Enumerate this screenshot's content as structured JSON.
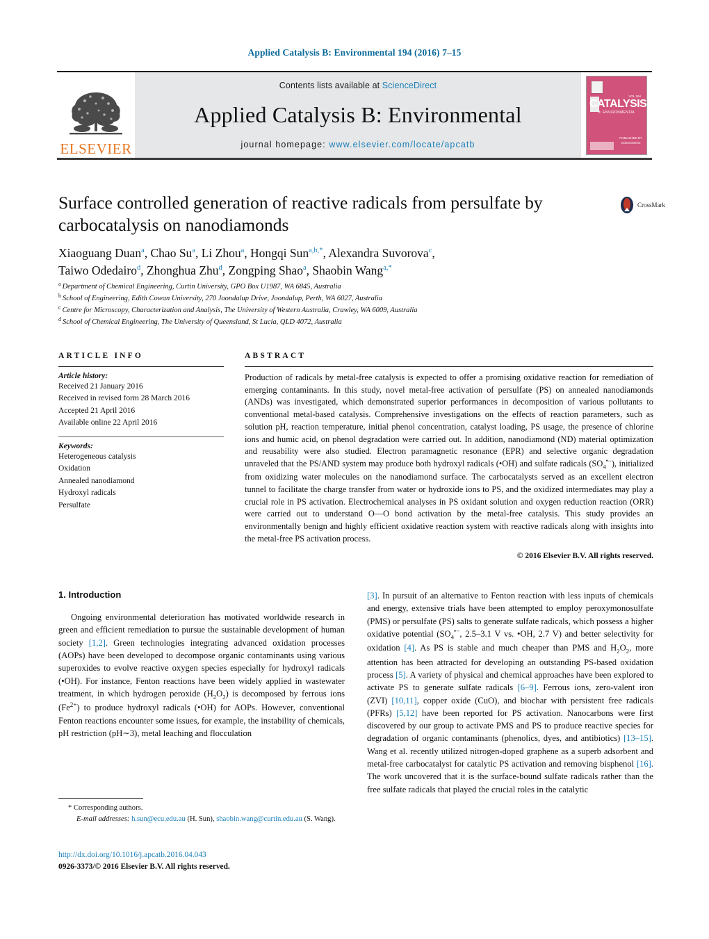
{
  "running_head": "Applied Catalysis B: Environmental 194 (2016) 7–15",
  "masthead": {
    "contents_prefix": "Contents lists available at ",
    "contents_link": "ScienceDirect",
    "journal_title": "Applied Catalysis B: Environmental",
    "homepage_prefix": "journal homepage: ",
    "homepage_url": "www.elsevier.com/locate/apcatb",
    "publisher": "ELSEVIER",
    "cover": {
      "title": "CATALYSIS",
      "subtitle": "B: ENVIRONMENTAL",
      "corner_label": "VOL 194",
      "footer_label": "PUBLISHED BY",
      "footer_brand": "ScienceDirect"
    }
  },
  "title": "Surface controlled generation of reactive radicals from persulfate by carbocatalysis on nanodiamonds",
  "crossmark": {
    "label": "CrossMark"
  },
  "authors_line_1": "Xiaoguang Duan<sup>a</sup>, Chao Su<sup>a</sup>, Li Zhou<sup>a</sup>, Hongqi Sun<sup>a,b,*</sup>, Alexandra Suvorova<sup>c</sup>,",
  "authors_line_2": "Taiwo Odedairo<sup>d</sup>, Zhonghua Zhu<sup>d</sup>, Zongping Shao<sup>a</sup>, Shaobin Wang<sup>a,*</sup>",
  "affiliations": [
    {
      "marker": "a",
      "text": "Department of Chemical Engineering, Curtin University, GPO Box U1987, WA 6845, Australia"
    },
    {
      "marker": "b",
      "text": "School of Engineering, Edith Cowan University, 270 Joondalup Drive, Joondalup, Perth, WA 6027, Australia"
    },
    {
      "marker": "c",
      "text": "Centre for Microscopy, Characterization and Analysis, The University of Western Australia, Crawley, WA 6009, Australia"
    },
    {
      "marker": "d",
      "text": "School of Chemical Engineering, The University of Queensland, St Lucia, QLD 4072, Australia"
    }
  ],
  "article_info": {
    "heading": "ARTICLE INFO",
    "history_label": "Article history:",
    "history": [
      "Received 21 January 2016",
      "Received in revised form 28 March 2016",
      "Accepted 21 April 2016",
      "Available online 22 April 2016"
    ],
    "keywords_label": "Keywords:",
    "keywords": [
      "Heterogeneous catalysis",
      "Oxidation",
      "Annealed nanodiamond",
      "Hydroxyl radicals",
      "Persulfate"
    ]
  },
  "abstract": {
    "heading": "ABSTRACT",
    "text": "Production of radicals by metal-free catalysis is expected to offer a promising oxidative reaction for remediation of emerging contaminants. In this study, novel metal-free activation of persulfate (PS) on annealed nanodiamonds (ANDs) was investigated, which demonstrated superior performances in decomposition of various pollutants to conventional metal-based catalysis. Comprehensive investigations on the effects of reaction parameters, such as solution pH, reaction temperature, initial phenol concentration, catalyst loading, PS usage, the presence of chlorine ions and humic acid, on phenol degradation were carried out. In addition, nanodiamond (ND) material optimization and reusability were also studied. Electron paramagnetic resonance (EPR) and selective organic degradation unraveled that the PS/AND system may produce both hydroxyl radicals (•OH) and sulfate radicals (SO4•−), initialized from oxidizing water molecules on the nanodiamond surface. The carbocatalysts served as an excellent electron tunnel to facilitate the charge transfer from water or hydroxide ions to PS, and the oxidized intermediates may play a crucial role in PS activation. Electrochemical analyses in PS oxidant solution and oxygen reduction reaction (ORR) were carried out to understand O—O bond activation by the metal-free catalysis. This study provides an environmentally benign and highly efficient oxidative reaction system with reactive radicals along with insights into the metal-free PS activation process.",
    "copyright": "© 2016 Elsevier B.V. All rights reserved."
  },
  "body": {
    "section_heading": "1. Introduction",
    "left_paragraph": "Ongoing environmental deterioration has motivated worldwide research in green and efficient remediation to pursue the sustainable development of human society [1,2]. Green technologies integrating advanced oxidation processes (AOPs) have been developed to decompose organic contaminants using various superoxides to evolve reactive oxygen species especially for hydroxyl radicals (•OH). For instance, Fenton reactions have been widely applied in wastewater treatment, in which hydrogen peroxide (H2O2) is decomposed by ferrous ions (Fe2+) to produce hydroxyl radicals (•OH) for AOPs. However, conventional Fenton reactions encounter some issues, for example, the instability of chemicals, pH restriction (pH∼3), metal leaching and flocculation",
    "right_paragraph": "[3]. In pursuit of an alternative to Fenton reaction with less inputs of chemicals and energy, extensive trials have been attempted to employ peroxymonosulfate (PMS) or persulfate (PS) salts to generate sulfate radicals, which possess a higher oxidative potential (SO4•−, 2.5–3.1 V vs. •OH, 2.7 V) and better selectivity for oxidation [4]. As PS is stable and much cheaper than PMS and H2O2, more attention has been attracted for developing an outstanding PS-based oxidation process [5]. A variety of physical and chemical approaches have been explored to activate PS to generate sulfate radicals [6–9]. Ferrous ions, zero-valent iron (ZVI) [10,11], copper oxide (CuO), and biochar with persistent free radicals (PFRs) [5,12] have been reported for PS activation. Nanocarbons were first discovered by our group to activate PMS and PS to produce reactive species for degradation of organic contaminants (phenolics, dyes, and antibiotics) [13–15]. Wang et al. recently utilized nitrogen-doped graphene as a superb adsorbent and metal-free carbocatalyst for catalytic PS activation and removing bisphenol [16]. The work uncovered that it is the surface-bound sulfate radicals rather than the free sulfate radicals that played the crucial roles in the catalytic"
  },
  "footnotes": {
    "corresponding": "* Corresponding authors.",
    "email_label": "E-mail addresses:",
    "email_1": "h.sun@ecu.edu.au",
    "email_1_owner": "(H. Sun),",
    "email_2": "shaobin.wang@curtin.edu.au",
    "email_2_owner": "(S. Wang)."
  },
  "doi": "http://dx.doi.org/10.1016/j.apcatb.2016.04.043",
  "issn_line": "0926-3373/© 2016 Elsevier B.V. All rights reserved.",
  "colors": {
    "link": "#1a7fb8",
    "running_head": "#0b6a9b",
    "elsevier_orange": "#E87722",
    "cover_pink": "#d1527a",
    "masthead_grey": "#e6e7e8"
  }
}
